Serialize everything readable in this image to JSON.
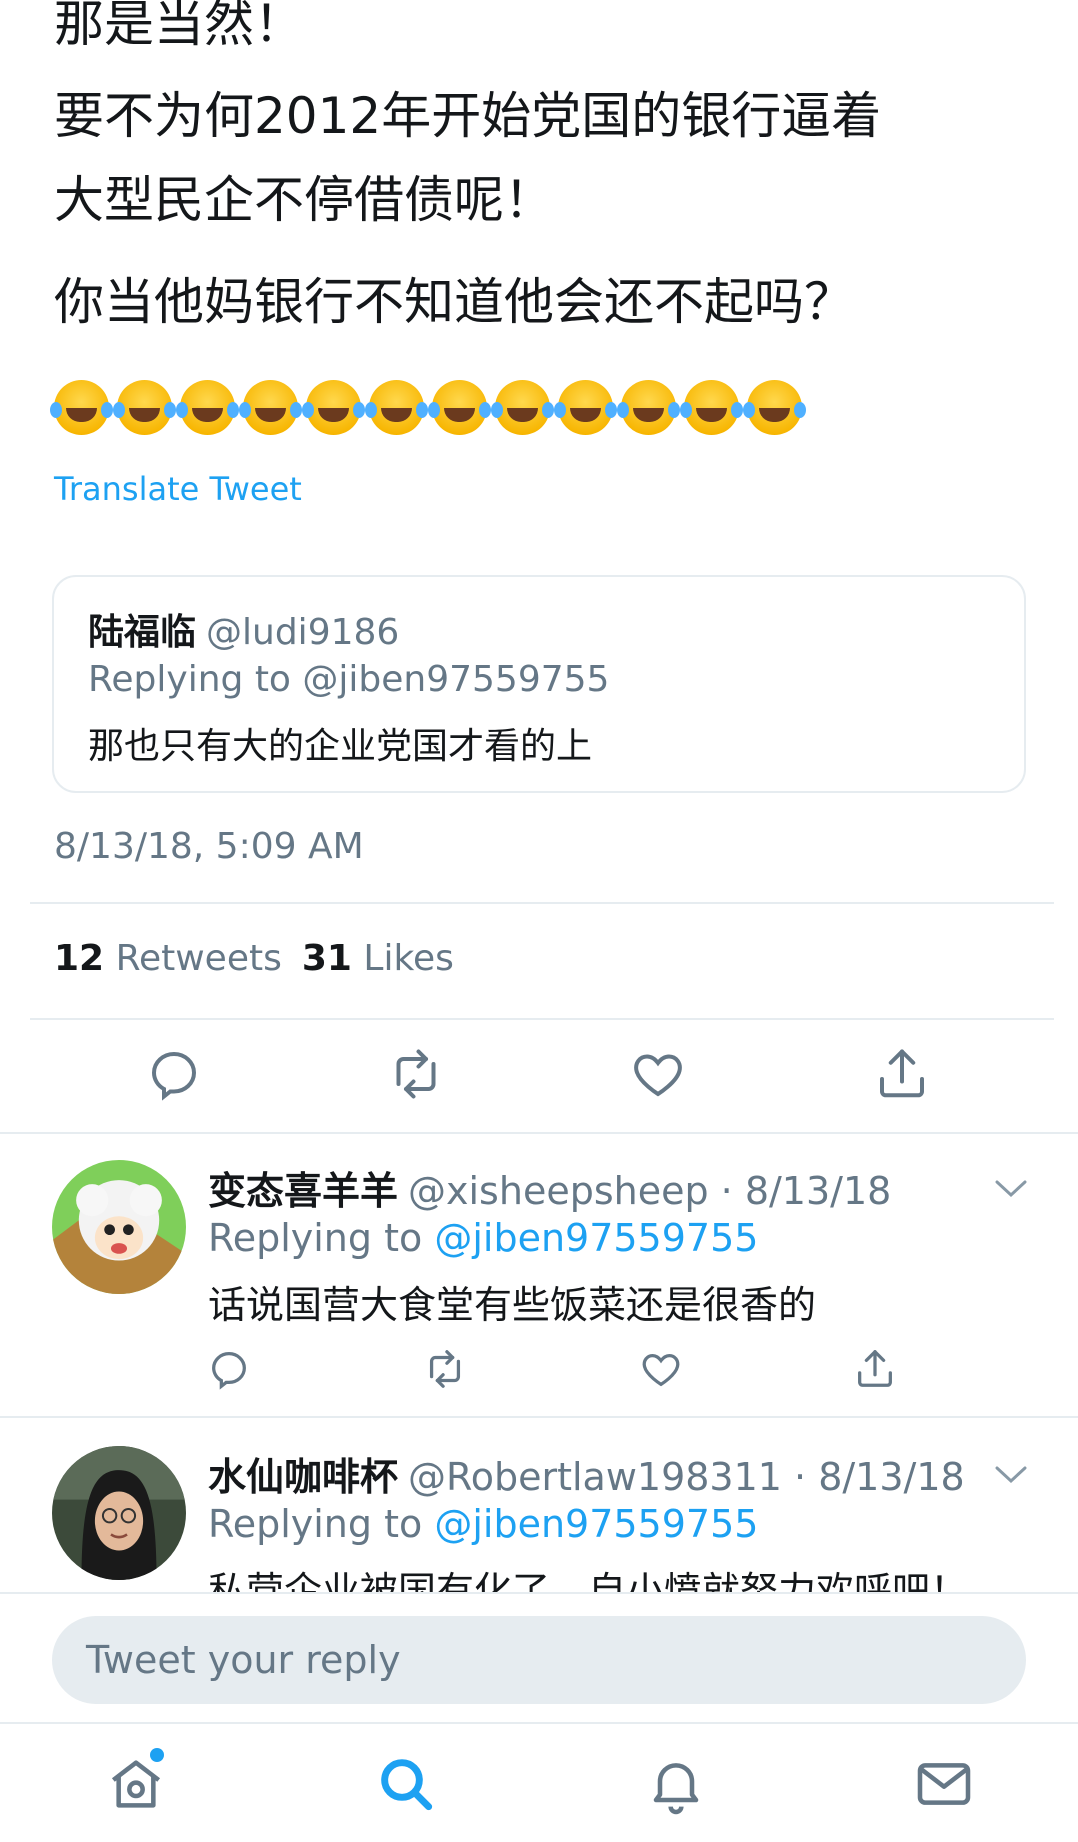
{
  "tweet": {
    "lines": [
      "那是当然！",
      "要不为何2012年开始党国的银行逼着",
      "大型民企不停借债呢！",
      "你当他妈银行不知道他会还不起吗？"
    ],
    "emoji_count": "12",
    "translate_label": "Translate Tweet",
    "timestamp": "8/13/18, 5:09 AM",
    "retweets_count": "12",
    "retweets_label": "Retweets",
    "likes_count": "31",
    "likes_label": "Likes"
  },
  "quoted": {
    "name": "陆福临",
    "handle": "@ludi9186",
    "replying": "Replying to @jiben97559755",
    "text": "那也只有大的企业党国才看的上"
  },
  "replies": [
    {
      "name": "变态喜羊羊",
      "meta": "@xisheepsheep · 8/13/18",
      "replying_prefix": "Replying to",
      "mention": "@jiben97559755",
      "text": "话说国营大食堂有些饭菜还是很香的"
    },
    {
      "name": "水仙咖啡杯",
      "meta": "@Robertlaw198311 · 8/13/18",
      "replying_prefix": "Replying to",
      "mention": "@jiben97559755",
      "text": "私营企业被国有化了，自小愤就努力欢呼吧！"
    }
  ],
  "composer": {
    "placeholder": "Tweet your reply"
  },
  "icons": {
    "reply": "reply-icon",
    "retweet": "retweet-icon",
    "like": "heart-icon",
    "share": "share-icon",
    "home": "home-icon",
    "search": "search-icon",
    "notifications": "bell-icon",
    "messages": "mail-icon"
  },
  "colors": {
    "accent": "#1da1f2",
    "text": "#14171a",
    "secondary": "#657786",
    "border": "#e6ecf0"
  }
}
